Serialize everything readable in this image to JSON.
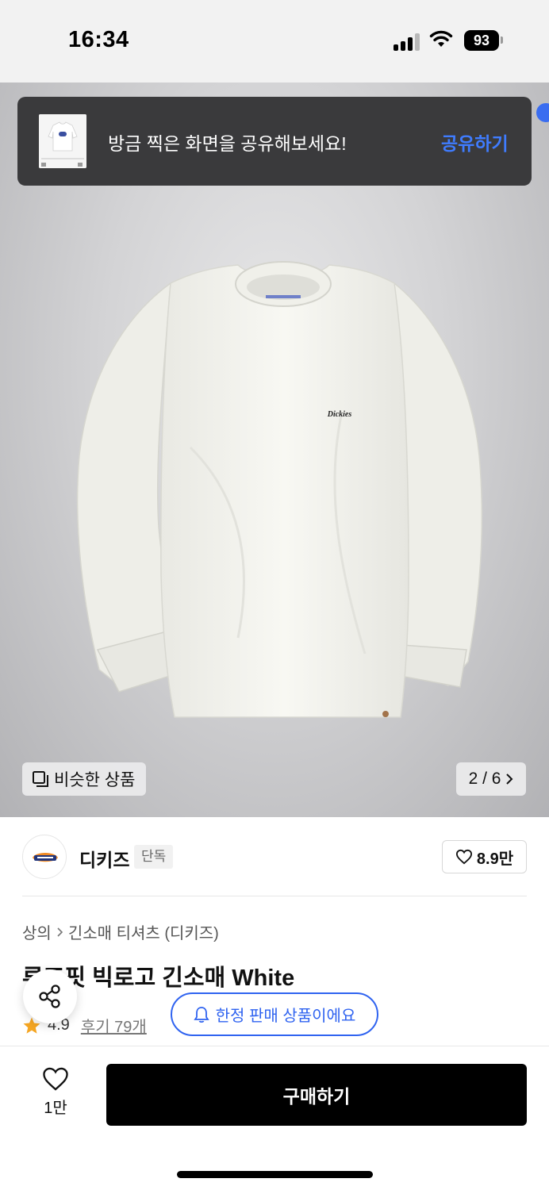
{
  "status_bar": {
    "time": "16:34",
    "battery": "93"
  },
  "toast": {
    "message": "방금 찍은 화면을 공유해보세요!",
    "action": "공유하기"
  },
  "gallery": {
    "similar_label": "비슷한 상품",
    "page_indicator": "2 / 6",
    "tshirt_logo": "Dickies"
  },
  "brand": {
    "name": "디키즈",
    "badge": "단독",
    "likes": "8.9만"
  },
  "breadcrumb": {
    "category": "상의",
    "subcategory": "긴소매 티셔츠 (디키즈)"
  },
  "product": {
    "title": "루즈핏 빅로고 긴소매 White",
    "rating": "4.9",
    "reviews": "후기 79개",
    "limited_notice": "한정 판매 상품이에요"
  },
  "bottom_bar": {
    "fav_count": "1만",
    "buy_label": "구매하기"
  },
  "colors": {
    "accent_blue": "#2f63f0",
    "share_blue": "#3f7cff",
    "toast_bg": "#3a3a3c",
    "star": "#f5a623"
  },
  "icons": [
    "signal-icon",
    "wifi-icon",
    "battery-icon",
    "similar-products-icon",
    "chevron-right-icon",
    "heart-icon",
    "share-icon",
    "bell-icon",
    "star-icon"
  ]
}
